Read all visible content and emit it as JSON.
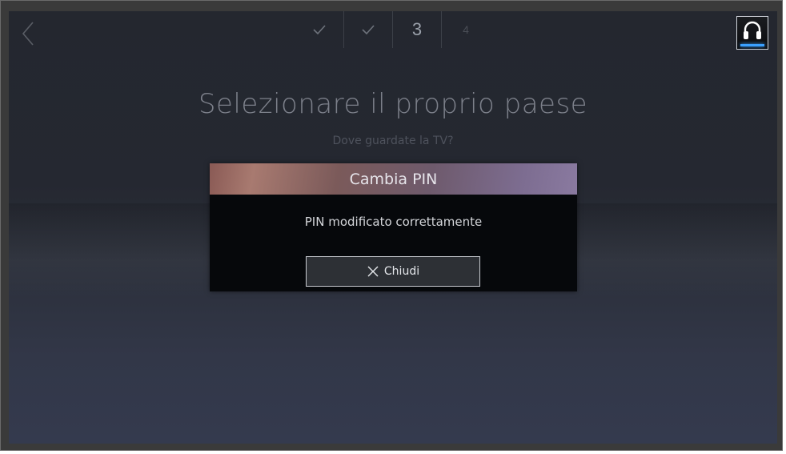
{
  "screen": {
    "title": "Selezionare il proprio paese",
    "subtitle": "Dove guardate la TV?"
  },
  "steps": {
    "items": [
      {
        "state": "done",
        "icon": "checkmark-icon"
      },
      {
        "state": "done",
        "icon": "checkmark-icon"
      },
      {
        "state": "current",
        "label": "3"
      },
      {
        "state": "future",
        "label": "4"
      }
    ]
  },
  "controls": {
    "back_icon": "chevron-left-icon",
    "headset_icon": "headset-icon"
  },
  "dialog": {
    "title": "Cambia PIN",
    "message": "PIN modificato correttamente",
    "close_label": "Chiudi",
    "close_icon": "close-icon"
  },
  "colors": {
    "accent_glow": "#3aa0ff",
    "dialog_header_start": "#a87a70",
    "dialog_header_end": "#8a7aa0"
  }
}
